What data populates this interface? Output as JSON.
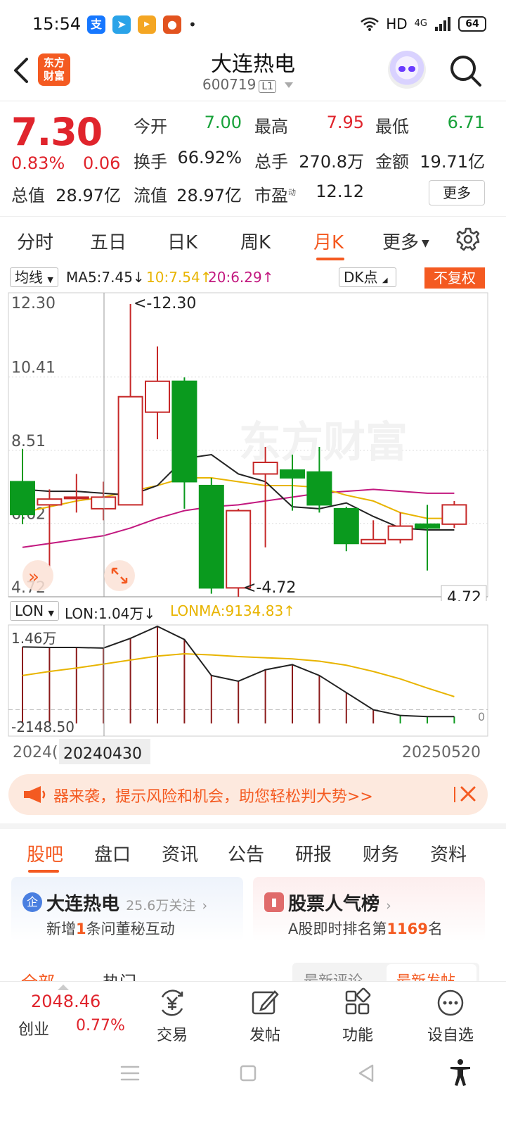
{
  "status_bar": {
    "time": "15:54",
    "network": "HD",
    "signal": "4G",
    "battery": "64",
    "app_icons": [
      "alipay-icon",
      "paper-plane-icon",
      "video-app-icon",
      "cat-app-icon"
    ],
    "dot": "•"
  },
  "header": {
    "logo_line1": "东方",
    "logo_line2": "财富",
    "stock_name": "大连热电",
    "stock_code": "600719",
    "level_badge": "L1"
  },
  "quote": {
    "price": "7.30",
    "change_pct": "0.83%",
    "change": "0.06",
    "open_label": "今开",
    "open": "7.00",
    "high_label": "最高",
    "high": "7.95",
    "low_label": "最低",
    "low": "6.71",
    "turnover_label": "换手",
    "turnover": "66.92%",
    "volume_label": "总手",
    "volume": "270.8万",
    "amount_label": "金额",
    "amount": "19.71亿",
    "mktcap_label": "总值",
    "mktcap": "28.97亿",
    "float_label": "流值",
    "float": "28.97亿",
    "pe_label": "市盈",
    "pe_sup": "动",
    "pe": "12.12",
    "more_button": "更多"
  },
  "period_tabs": {
    "items": [
      "分时",
      "五日",
      "日K",
      "周K",
      "月K",
      "更多"
    ],
    "active": "月K"
  },
  "indicators": {
    "ma_selector": "均线",
    "ma5": "MA5:7.45↓",
    "ma10": "10:7.54↑",
    "ma20": "20:6.29↑",
    "dk_button": "DK点",
    "fuquan_button": "不复权",
    "lon_selector": "LON",
    "lon_value": "LON:1.04万↓",
    "lonma_value": "LONMA:9134.83↑",
    "colors": {
      "ma5": "#222222",
      "ma10": "#e8b400",
      "ma20": "#c2187f",
      "up": "#c62828",
      "down": "#0a9a1e",
      "accent": "#f45a21"
    }
  },
  "chart_data": [
    {
      "type": "candlestick",
      "y_axis_labels": [
        "12.30",
        "10.41",
        "8.51",
        "6.62",
        "4.72"
      ],
      "ylim": [
        4.72,
        12.3
      ],
      "max_annotation": "<-12.30",
      "min_annotation": "<-4.72",
      "last_price_tag": "4.72",
      "candles": [
        {
          "o": 7.7,
          "c": 6.85,
          "h": 8.55,
          "l": 6.6
        },
        {
          "o": 7.1,
          "c": 7.25,
          "h": 7.5,
          "l": 5.5
        },
        {
          "o": 7.3,
          "c": 7.3,
          "h": 7.9,
          "l": 6.9
        },
        {
          "o": 7.0,
          "c": 7.3,
          "h": 7.7,
          "l": 6.7
        },
        {
          "o": 7.1,
          "c": 9.9,
          "h": 12.3,
          "l": 7.1
        },
        {
          "o": 9.5,
          "c": 10.3,
          "h": 11.2,
          "l": 8.8
        },
        {
          "o": 10.3,
          "c": 7.7,
          "h": 10.4,
          "l": 7.0
        },
        {
          "o": 7.6,
          "c": 4.95,
          "h": 7.8,
          "l": 4.8
        },
        {
          "o": 4.95,
          "c": 6.95,
          "h": 7.0,
          "l": 4.72
        },
        {
          "o": 7.9,
          "c": 8.2,
          "h": 8.6,
          "l": 6.0
        },
        {
          "o": 8.0,
          "c": 7.8,
          "h": 8.4,
          "l": 6.95
        },
        {
          "o": 7.95,
          "c": 7.1,
          "h": 8.6,
          "l": 6.9
        },
        {
          "o": 7.0,
          "c": 6.1,
          "h": 7.05,
          "l": 5.9
        },
        {
          "o": 6.1,
          "c": 6.2,
          "h": 6.7,
          "l": 6.1
        },
        {
          "o": 6.2,
          "c": 6.55,
          "h": 6.9,
          "l": 6.1
        },
        {
          "o": 6.6,
          "c": 6.5,
          "h": 7.1,
          "l": 5.4
        },
        {
          "o": 6.6,
          "c": 7.1,
          "h": 7.2,
          "l": 6.5
        }
      ],
      "ma5": [
        7.5,
        7.45,
        7.45,
        7.4,
        7.35,
        7.6,
        8.3,
        8.4,
        7.9,
        7.7,
        7.05,
        7.0,
        7.15,
        6.8,
        6.5,
        6.45,
        6.45
      ],
      "ma10": [
        6.9,
        7.05,
        7.2,
        7.3,
        7.45,
        7.6,
        7.8,
        7.8,
        7.7,
        7.6,
        7.6,
        7.55,
        7.35,
        7.2,
        6.9,
        6.75,
        6.75
      ],
      "ma20": [
        6.0,
        6.1,
        6.2,
        6.3,
        6.5,
        6.75,
        6.95,
        7.05,
        7.1,
        7.2,
        7.3,
        7.4,
        7.45,
        7.5,
        7.45,
        7.4,
        7.4
      ]
    },
    {
      "type": "bar",
      "name": "LON",
      "y_axis_labels": [
        "1.46万",
        "-2148.50"
      ],
      "ylim": [
        -2148.5,
        14600
      ],
      "zero_label": "0",
      "bars": [
        11000,
        11000,
        11000,
        10800,
        12500,
        14600,
        12300,
        6000,
        5000,
        7000,
        8000,
        6000,
        3000,
        0,
        -1000,
        -1200,
        -1200
      ],
      "lon": [
        11000,
        10900,
        10900,
        10800,
        12500,
        14600,
        12300,
        6000,
        5000,
        7000,
        7900,
        6000,
        3000,
        0,
        -1000,
        -1200,
        -1200
      ],
      "lonma": [
        6000,
        6700,
        7300,
        8000,
        8700,
        9400,
        9800,
        9600,
        9300,
        9100,
        8900,
        8500,
        7800,
        6700,
        5400,
        3800,
        2300
      ],
      "x_labels": [
        "2024( ",
        "20240430",
        "20250520"
      ]
    }
  ],
  "promo": {
    "text": "器来袭，提示风险和机会，助您轻松判大势>>"
  },
  "section_tabs": {
    "items": [
      "股吧",
      "盘口",
      "资讯",
      "公告",
      "研报",
      "财务",
      "资料"
    ],
    "active": "股吧"
  },
  "cards": {
    "left": {
      "icon_text": "企",
      "title": "大连热电",
      "followers": "25.6万关注",
      "arrow": "›",
      "sub_prefix": "新增",
      "sub_count": "1",
      "sub_suffix": "条问董秘互动"
    },
    "right": {
      "title": "股票人气榜",
      "arrow": "›",
      "sub_prefix": "A股即时排名第",
      "sub_rank": "1169",
      "sub_suffix": "名"
    }
  },
  "sub_tabs": {
    "left": [
      "全部",
      "热门"
    ],
    "right": [
      "最新评论",
      "最新发帖"
    ]
  },
  "bottom_nav": {
    "index_value": "2048.46",
    "index_name": "创业",
    "index_pct": "0.77%",
    "items": [
      "交易",
      "发帖",
      "功能",
      "设自选"
    ]
  }
}
